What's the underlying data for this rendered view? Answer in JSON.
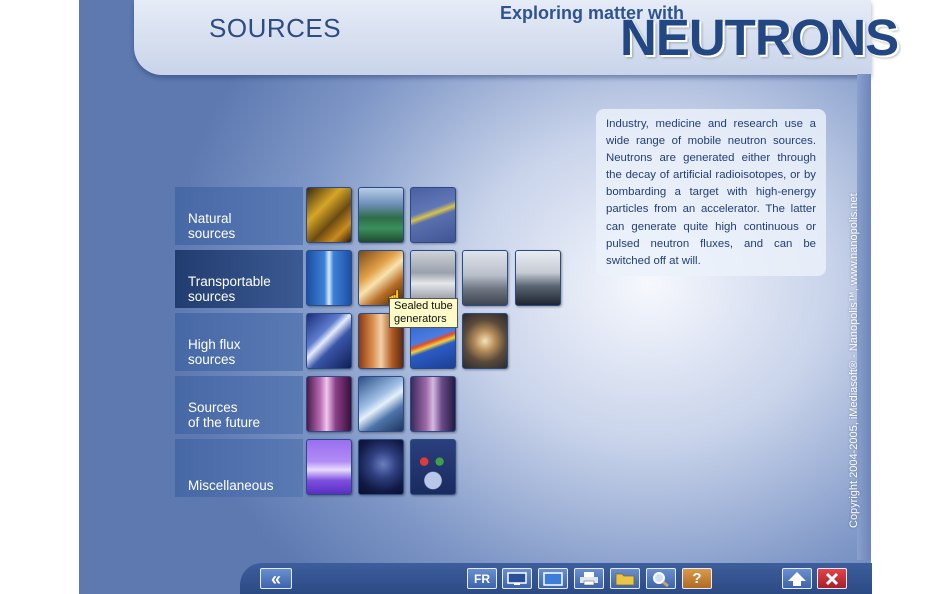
{
  "header": {
    "page_title": "SOURCES",
    "tagline": "Exploring matter with",
    "brand": "NEUTRONS"
  },
  "info": {
    "text": "Industry, medicine and research use a wide range of mobile neutron sources. Neutrons are generated either through the decay of artificial radioisotopes, or by bombarding a target with high-energy particles from an accelerator. The latter can generate quite high continuous or pulsed neutron fluxes, and can be switched off at will."
  },
  "copyright": "Copyright 2004-2005, iMediasoft® - Nanopolis™, www.nanopolis.net",
  "categories": [
    {
      "line1": "Natural",
      "line2": "sources",
      "thumbs": 3
    },
    {
      "line1": "Transportable",
      "line2": "sources",
      "thumbs": 5
    },
    {
      "line1": "High flux",
      "line2": "sources",
      "thumbs": 4
    },
    {
      "line1": "Sources",
      "line2": "of the future",
      "thumbs": 3
    },
    {
      "line1": "",
      "line2": "Miscellaneous",
      "thumbs": 3
    }
  ],
  "tooltip": {
    "line1": "Sealed tube",
    "line2": "generators"
  },
  "toolbar": {
    "back_label": "«",
    "lang_label": "FR",
    "icons": [
      "rewind-icon",
      "language-icon",
      "monitor-icon",
      "window-icon",
      "print-icon",
      "folder-icon",
      "search-icon",
      "help-icon",
      "up-arrow-icon",
      "close-icon"
    ]
  },
  "colors": {
    "accent": "#224783",
    "panel": "#c9d4ea",
    "tooltip": "#fdfbc8",
    "close": "#c9303a",
    "help": "#c67b2a"
  }
}
